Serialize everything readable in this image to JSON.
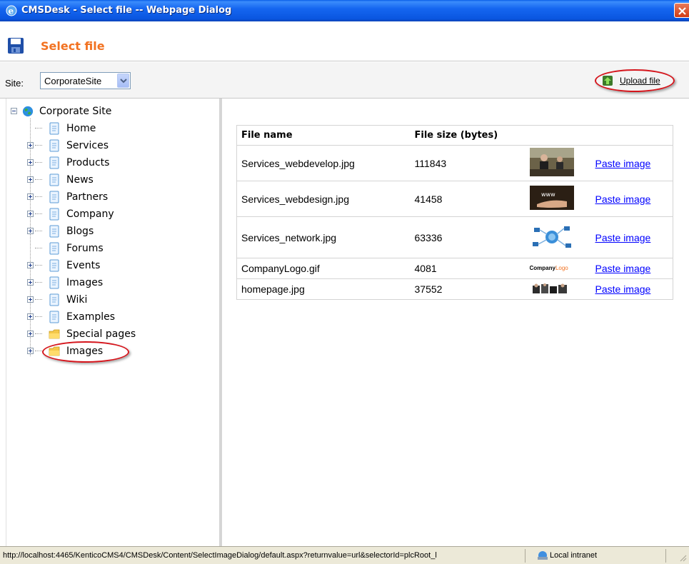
{
  "window": {
    "title": "CMSDesk - Select file -- Webpage Dialog"
  },
  "dialog": {
    "title": "Select file",
    "title_color": "#f27221"
  },
  "toolbar": {
    "site_label": "Site:",
    "site_value": "CorporateSite",
    "upload_label": "Upload file"
  },
  "tree": {
    "root": "Corporate Site",
    "items": [
      {
        "label": "Home",
        "icon": "page-icon",
        "expandable": false
      },
      {
        "label": "Services",
        "icon": "page-icon",
        "expandable": true
      },
      {
        "label": "Products",
        "icon": "page-icon",
        "expandable": true
      },
      {
        "label": "News",
        "icon": "page-icon",
        "expandable": true
      },
      {
        "label": "Partners",
        "icon": "page-icon",
        "expandable": true
      },
      {
        "label": "Company",
        "icon": "page-icon",
        "expandable": true
      },
      {
        "label": "Blogs",
        "icon": "page-icon",
        "expandable": true
      },
      {
        "label": "Forums",
        "icon": "page-icon",
        "expandable": false
      },
      {
        "label": "Events",
        "icon": "page-icon",
        "expandable": true
      },
      {
        "label": "Images",
        "icon": "page-icon",
        "expandable": true
      },
      {
        "label": "Wiki",
        "icon": "page-icon",
        "expandable": true
      },
      {
        "label": "Examples",
        "icon": "page-icon",
        "expandable": true
      },
      {
        "label": "Special pages",
        "icon": "folder-icon",
        "expandable": true
      },
      {
        "label": "Images",
        "icon": "folder-icon",
        "expandable": true,
        "selected": true
      }
    ]
  },
  "files": {
    "headers": [
      "File name",
      "File size (bytes)"
    ],
    "rows": [
      {
        "name": "Services_webdevelop.jpg",
        "size": "111843",
        "action": "Paste image",
        "thumb": "business-meeting-thumb"
      },
      {
        "name": "Services_webdesign.jpg",
        "size": "41458",
        "action": "Paste image",
        "thumb": "hand-www-thumb"
      },
      {
        "name": "Services_network.jpg",
        "size": "63336",
        "action": "Paste image",
        "thumb": "network-globe-thumb"
      },
      {
        "name": "CompanyLogo.gif",
        "size": "4081",
        "action": "Paste image",
        "thumb": "company-logo-thumb"
      },
      {
        "name": "homepage.jpg",
        "size": "37552",
        "action": "Paste image",
        "thumb": "homepage-thumb"
      }
    ],
    "logo_text_dark": "Company",
    "logo_text_accent": "Logo"
  },
  "statusbar": {
    "url": "http://localhost:4465/KenticoCMS4/CMSDesk/Content/SelectImageDialog/default.aspx?returnvalue=url&selectorId=plcRoot_l",
    "zone": "Local intranet"
  },
  "colors": {
    "link": "#0000ff",
    "highlight": "#d5151c",
    "titlebar": "#0a56e0"
  }
}
